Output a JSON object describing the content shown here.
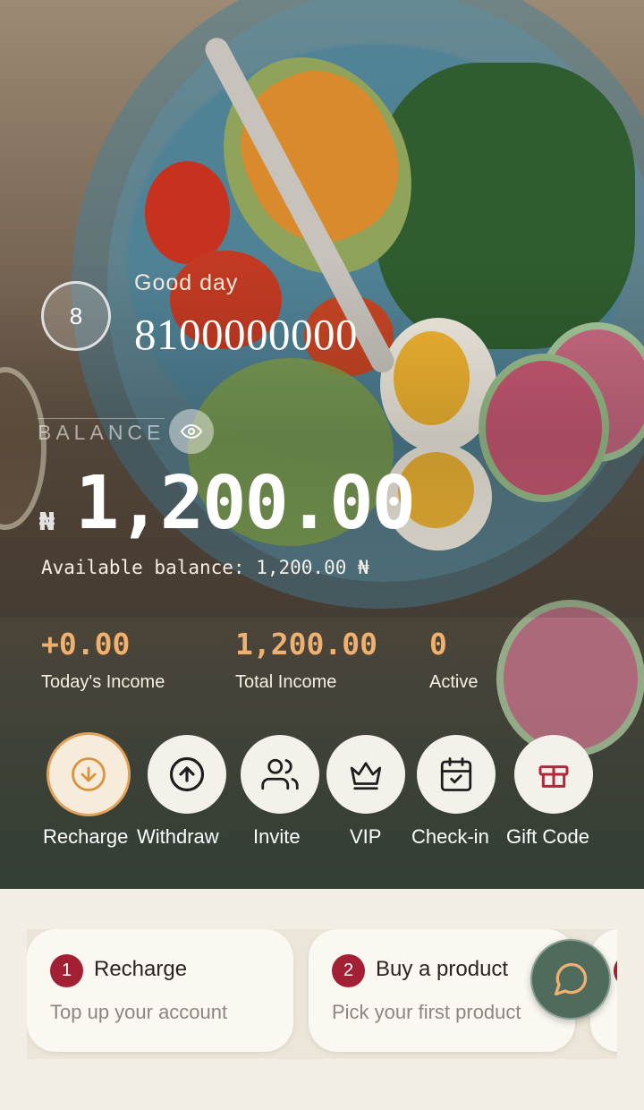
{
  "header": {
    "avatar_text": "8",
    "greeting": "Good day",
    "phone": "8100000000"
  },
  "balance": {
    "label": "BALANCE",
    "currency": "₦",
    "amount": "1,200.00",
    "available": "Available balance: 1,200.00 ₦"
  },
  "stats": [
    {
      "value": "+0.00",
      "label": "Today's Income"
    },
    {
      "value": "1,200.00",
      "label": "Total Income"
    },
    {
      "value": "0",
      "label": "Active"
    }
  ],
  "actions": [
    {
      "label": "Recharge",
      "icon": "arrow-down-circle-icon"
    },
    {
      "label": "Withdraw",
      "icon": "arrow-up-circle-icon"
    },
    {
      "label": "Invite",
      "icon": "users-icon"
    },
    {
      "label": "VIP",
      "icon": "crown-icon"
    },
    {
      "label": "Check-in",
      "icon": "calendar-check-icon"
    },
    {
      "label": "Gift Code",
      "icon": "gift-icon"
    }
  ],
  "steps": [
    {
      "num": "1",
      "title": "Recharge",
      "subtitle": "Top up your account"
    },
    {
      "num": "2",
      "title": "Buy a product",
      "subtitle": "Pick your first product"
    }
  ],
  "colors": {
    "accent": "#f0b070",
    "step_badge": "#a31f34",
    "chat_button": "#4f6b5b",
    "highlight_ring": "#e2a25c"
  }
}
